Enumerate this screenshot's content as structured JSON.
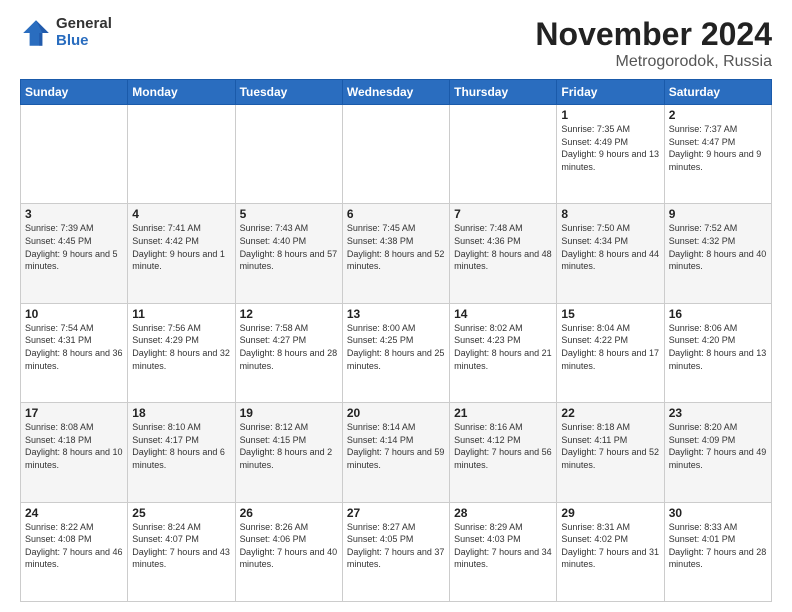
{
  "logo": {
    "general": "General",
    "blue": "Blue"
  },
  "title": {
    "month_year": "November 2024",
    "location": "Metrogorodok, Russia"
  },
  "weekdays": [
    "Sunday",
    "Monday",
    "Tuesday",
    "Wednesday",
    "Thursday",
    "Friday",
    "Saturday"
  ],
  "weeks": [
    [
      {
        "day": "",
        "info": ""
      },
      {
        "day": "",
        "info": ""
      },
      {
        "day": "",
        "info": ""
      },
      {
        "day": "",
        "info": ""
      },
      {
        "day": "",
        "info": ""
      },
      {
        "day": "1",
        "info": "Sunrise: 7:35 AM\nSunset: 4:49 PM\nDaylight: 9 hours and 13 minutes."
      },
      {
        "day": "2",
        "info": "Sunrise: 7:37 AM\nSunset: 4:47 PM\nDaylight: 9 hours and 9 minutes."
      }
    ],
    [
      {
        "day": "3",
        "info": "Sunrise: 7:39 AM\nSunset: 4:45 PM\nDaylight: 9 hours and 5 minutes."
      },
      {
        "day": "4",
        "info": "Sunrise: 7:41 AM\nSunset: 4:42 PM\nDaylight: 9 hours and 1 minute."
      },
      {
        "day": "5",
        "info": "Sunrise: 7:43 AM\nSunset: 4:40 PM\nDaylight: 8 hours and 57 minutes."
      },
      {
        "day": "6",
        "info": "Sunrise: 7:45 AM\nSunset: 4:38 PM\nDaylight: 8 hours and 52 minutes."
      },
      {
        "day": "7",
        "info": "Sunrise: 7:48 AM\nSunset: 4:36 PM\nDaylight: 8 hours and 48 minutes."
      },
      {
        "day": "8",
        "info": "Sunrise: 7:50 AM\nSunset: 4:34 PM\nDaylight: 8 hours and 44 minutes."
      },
      {
        "day": "9",
        "info": "Sunrise: 7:52 AM\nSunset: 4:32 PM\nDaylight: 8 hours and 40 minutes."
      }
    ],
    [
      {
        "day": "10",
        "info": "Sunrise: 7:54 AM\nSunset: 4:31 PM\nDaylight: 8 hours and 36 minutes."
      },
      {
        "day": "11",
        "info": "Sunrise: 7:56 AM\nSunset: 4:29 PM\nDaylight: 8 hours and 32 minutes."
      },
      {
        "day": "12",
        "info": "Sunrise: 7:58 AM\nSunset: 4:27 PM\nDaylight: 8 hours and 28 minutes."
      },
      {
        "day": "13",
        "info": "Sunrise: 8:00 AM\nSunset: 4:25 PM\nDaylight: 8 hours and 25 minutes."
      },
      {
        "day": "14",
        "info": "Sunrise: 8:02 AM\nSunset: 4:23 PM\nDaylight: 8 hours and 21 minutes."
      },
      {
        "day": "15",
        "info": "Sunrise: 8:04 AM\nSunset: 4:22 PM\nDaylight: 8 hours and 17 minutes."
      },
      {
        "day": "16",
        "info": "Sunrise: 8:06 AM\nSunset: 4:20 PM\nDaylight: 8 hours and 13 minutes."
      }
    ],
    [
      {
        "day": "17",
        "info": "Sunrise: 8:08 AM\nSunset: 4:18 PM\nDaylight: 8 hours and 10 minutes."
      },
      {
        "day": "18",
        "info": "Sunrise: 8:10 AM\nSunset: 4:17 PM\nDaylight: 8 hours and 6 minutes."
      },
      {
        "day": "19",
        "info": "Sunrise: 8:12 AM\nSunset: 4:15 PM\nDaylight: 8 hours and 2 minutes."
      },
      {
        "day": "20",
        "info": "Sunrise: 8:14 AM\nSunset: 4:14 PM\nDaylight: 7 hours and 59 minutes."
      },
      {
        "day": "21",
        "info": "Sunrise: 8:16 AM\nSunset: 4:12 PM\nDaylight: 7 hours and 56 minutes."
      },
      {
        "day": "22",
        "info": "Sunrise: 8:18 AM\nSunset: 4:11 PM\nDaylight: 7 hours and 52 minutes."
      },
      {
        "day": "23",
        "info": "Sunrise: 8:20 AM\nSunset: 4:09 PM\nDaylight: 7 hours and 49 minutes."
      }
    ],
    [
      {
        "day": "24",
        "info": "Sunrise: 8:22 AM\nSunset: 4:08 PM\nDaylight: 7 hours and 46 minutes."
      },
      {
        "day": "25",
        "info": "Sunrise: 8:24 AM\nSunset: 4:07 PM\nDaylight: 7 hours and 43 minutes."
      },
      {
        "day": "26",
        "info": "Sunrise: 8:26 AM\nSunset: 4:06 PM\nDaylight: 7 hours and 40 minutes."
      },
      {
        "day": "27",
        "info": "Sunrise: 8:27 AM\nSunset: 4:05 PM\nDaylight: 7 hours and 37 minutes."
      },
      {
        "day": "28",
        "info": "Sunrise: 8:29 AM\nSunset: 4:03 PM\nDaylight: 7 hours and 34 minutes."
      },
      {
        "day": "29",
        "info": "Sunrise: 8:31 AM\nSunset: 4:02 PM\nDaylight: 7 hours and 31 minutes."
      },
      {
        "day": "30",
        "info": "Sunrise: 8:33 AM\nSunset: 4:01 PM\nDaylight: 7 hours and 28 minutes."
      }
    ]
  ]
}
